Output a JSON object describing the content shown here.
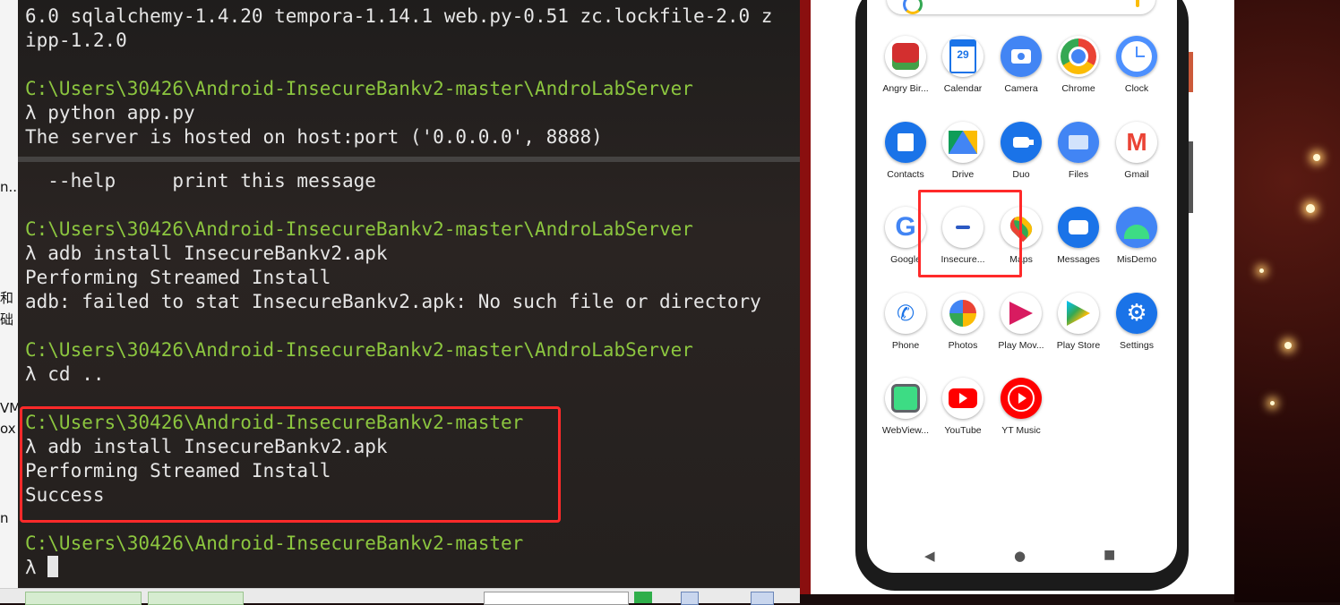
{
  "terminal": {
    "lines": [
      {
        "text": "6.0 sqlalchemy-1.4.20 tempora-1.14.1 web.py-0.51 zc.lockfile-2.0 z"
      },
      {
        "text": "ipp-1.2.0"
      },
      {
        "text": "C:\\Users\\30426\\Android-InsecureBankv2-master\\AndroLabServer"
      },
      {
        "text": "λ python app.py"
      },
      {
        "text": "The server is hosted on host:port ('0.0.0.0', 8888)"
      },
      {
        "text": "  --help     print this message"
      },
      {
        "text": "C:\\Users\\30426\\Android-InsecureBankv2-master\\AndroLabServer"
      },
      {
        "text": "λ adb install InsecureBankv2.apk"
      },
      {
        "text": "Performing Streamed Install"
      },
      {
        "text": "adb: failed to stat InsecureBankv2.apk: No such file or directory"
      },
      {
        "text": "C:\\Users\\30426\\Android-InsecureBankv2-master\\AndroLabServer"
      },
      {
        "text": "λ cd .."
      },
      {
        "text": "C:\\Users\\30426\\Android-InsecureBankv2-master"
      },
      {
        "text": "λ adb install InsecureBankv2.apk"
      },
      {
        "text": "Performing Streamed Install"
      },
      {
        "text": "Success"
      },
      {
        "text": "C:\\Users\\30426\\Android-InsecureBankv2-master"
      },
      {
        "text": "λ "
      }
    ]
  },
  "desktop_left": [
    "n...",
    "和",
    "础",
    "VM",
    "ox",
    "n"
  ],
  "phone": {
    "apps": [
      {
        "label": "Angry Bir...",
        "icon": "angry-birds-icon"
      },
      {
        "label": "Calendar",
        "icon": "calendar-icon",
        "day": "29"
      },
      {
        "label": "Camera",
        "icon": "camera-icon"
      },
      {
        "label": "Chrome",
        "icon": "chrome-icon"
      },
      {
        "label": "Clock",
        "icon": "clock-icon"
      },
      {
        "label": "Contacts",
        "icon": "contacts-icon"
      },
      {
        "label": "Drive",
        "icon": "drive-icon"
      },
      {
        "label": "Duo",
        "icon": "duo-icon"
      },
      {
        "label": "Files",
        "icon": "files-icon"
      },
      {
        "label": "Gmail",
        "icon": "gmail-icon"
      },
      {
        "label": "Google",
        "icon": "google-icon"
      },
      {
        "label": "Insecure...",
        "icon": "insecurebank-icon"
      },
      {
        "label": "Maps",
        "icon": "maps-icon"
      },
      {
        "label": "Messages",
        "icon": "messages-icon"
      },
      {
        "label": "MisDemo",
        "icon": "android-icon"
      },
      {
        "label": "Phone",
        "icon": "phone-icon"
      },
      {
        "label": "Photos",
        "icon": "photos-icon"
      },
      {
        "label": "Play Mov...",
        "icon": "play-movies-icon"
      },
      {
        "label": "Play Store",
        "icon": "play-store-icon"
      },
      {
        "label": "Settings",
        "icon": "settings-icon"
      },
      {
        "label": "WebView...",
        "icon": "webview-icon"
      },
      {
        "label": "YouTube",
        "icon": "youtube-icon"
      },
      {
        "label": "YT Music",
        "icon": "yt-music-icon"
      }
    ],
    "nav": {
      "back": "◀",
      "home": "●",
      "recents": "■"
    }
  },
  "colors": {
    "prompt_path": "#8cc63f",
    "highlight": "#ff2a2a"
  }
}
